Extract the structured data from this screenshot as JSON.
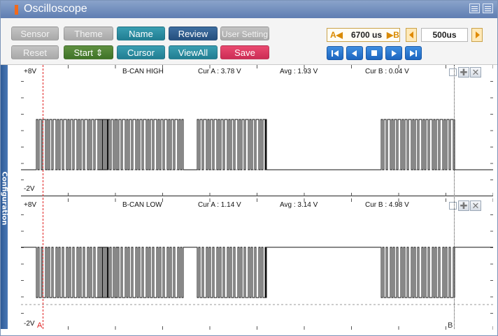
{
  "title": "Oscilloscope",
  "toolbar": {
    "row1": [
      {
        "label": "Sensor",
        "style": "gray"
      },
      {
        "label": "Theme",
        "style": "gray"
      },
      {
        "label": "Name",
        "style": "teal"
      },
      {
        "label": "Review",
        "style": "navy"
      },
      {
        "label": "User Setting",
        "style": "gray"
      }
    ],
    "row2": [
      {
        "label": "Reset",
        "style": "gray"
      },
      {
        "label": "Start  ⇕",
        "style": "green"
      },
      {
        "label": "Cursor",
        "style": "teal"
      },
      {
        "label": "ViewAll",
        "style": "teal"
      },
      {
        "label": "Save",
        "style": "red"
      }
    ],
    "cursor_a_symbol": "A◀",
    "cursor_time": "6700 us",
    "cursor_b_symbol": "▶B",
    "time_scale": "500us",
    "playback": [
      "first-icon",
      "prev-icon",
      "stop-icon",
      "next-icon",
      "last-icon"
    ]
  },
  "sidetab": "Configuration",
  "channels": [
    {
      "name": "B-CAN HIGH",
      "vmax": "+8V",
      "vmin": "-2V",
      "cur_a": "Cur A : 3.78 V",
      "avg": "Avg : 1.93 V",
      "cur_b": "Cur B : 0.04 V"
    },
    {
      "name": "B-CAN LOW",
      "vmax": "+8V",
      "vmin": "-2V",
      "cur_a": "Cur A : 1.14 V",
      "avg": "Avg : 3.14 V",
      "cur_b": "Cur B : 4.98 V"
    }
  ],
  "cursor_a_label": "A",
  "cursor_b_label": "B",
  "colors": {
    "cursor_a": "#e02020",
    "cursor_b": "#555555",
    "trace": "#111111",
    "sidetab": "#2e5b97"
  }
}
